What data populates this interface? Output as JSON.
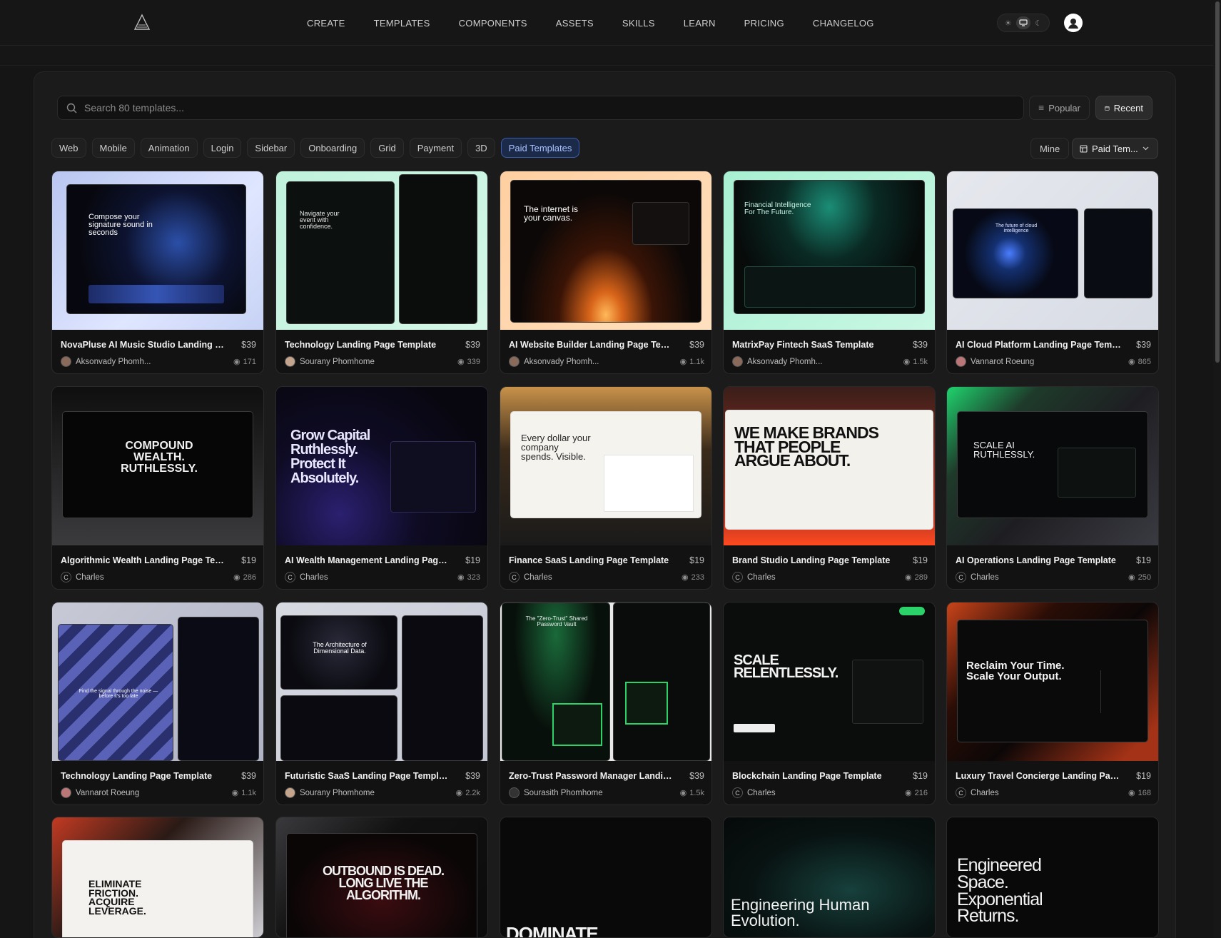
{
  "nav": {
    "items": [
      "CREATE",
      "TEMPLATES",
      "COMPONENTS",
      "ASSETS",
      "SKILLS",
      "LEARN",
      "PRICING",
      "CHANGELOG"
    ]
  },
  "search": {
    "placeholder": "Search 80 templates..."
  },
  "sort": {
    "popular": "Popular",
    "recent": "Recent",
    "active": "Recent"
  },
  "filters": {
    "chips": [
      "Web",
      "Mobile",
      "Animation",
      "Login",
      "Sidebar",
      "Onboarding",
      "Grid",
      "Payment",
      "3D",
      "Paid Templates"
    ],
    "selected": "Paid Templates",
    "mine": "Mine",
    "dropdown": "Paid Tem..."
  },
  "cards": [
    {
      "title": "NovaPluse AI Music Studio Landing Page...",
      "price": "$39",
      "author": "Aksonvady Phomh...",
      "views": "171",
      "hero": "Compose your signature sound in seconds"
    },
    {
      "title": "Technology Landing Page Template",
      "price": "$39",
      "author": "Sourany Phomhome",
      "views": "339",
      "hero": "Navigate your event with confidence."
    },
    {
      "title": "AI Website Builder Landing Page Template",
      "price": "$39",
      "author": "Aksonvady Phomh...",
      "views": "1.1k",
      "hero": "The internet is your canvas."
    },
    {
      "title": "MatrixPay Fintech SaaS Template",
      "price": "$39",
      "author": "Aksonvady Phomh...",
      "views": "1.5k",
      "hero": "Financial Intelligence For The Future."
    },
    {
      "title": "AI Cloud Platform Landing Page Template",
      "price": "$39",
      "author": "Vannarot Roeung",
      "views": "865",
      "hero": "The future of cloud intelligence"
    },
    {
      "title": "Algorithmic Wealth Landing Page Template",
      "price": "$19",
      "author": "Charles",
      "views": "286",
      "hero": "COMPOUND WEALTH. RUTHLESSLY."
    },
    {
      "title": "AI Wealth Management Landing Page Te...",
      "price": "$19",
      "author": "Charles",
      "views": "323",
      "hero": "Grow Capital Ruthlessly. Protect It Absolutely."
    },
    {
      "title": "Finance SaaS Landing Page Template",
      "price": "$19",
      "author": "Charles",
      "views": "233",
      "hero": "Every dollar your company spends. Visible."
    },
    {
      "title": "Brand Studio Landing Page Template",
      "price": "$19",
      "author": "Charles",
      "views": "289",
      "hero": "WE MAKE BRANDS THAT PEOPLE ARGUE ABOUT."
    },
    {
      "title": "AI Operations Landing Page Template",
      "price": "$19",
      "author": "Charles",
      "views": "250",
      "hero": "SCALE AI RUTHLESSLY."
    },
    {
      "title": "Technology Landing Page Template",
      "price": "$39",
      "author": "Vannarot Roeung",
      "views": "1.1k",
      "hero": "Find the signal through the noise — before it's too late"
    },
    {
      "title": "Futuristic SaaS Landing Page Template",
      "price": "$39",
      "author": "Sourany Phomhome",
      "views": "2.2k",
      "hero": "The Architecture of Dimensional Data."
    },
    {
      "title": "Zero-Trust Password Manager Landing P...",
      "price": "$39",
      "author": "Sourasith Phomhome",
      "views": "1.5k",
      "hero": "The \"Zero-Trust\" Shared Password Vault"
    },
    {
      "title": "Blockchain Landing Page Template",
      "price": "$19",
      "author": "Charles",
      "views": "216",
      "hero": "SCALE RELENTLESSLY."
    },
    {
      "title": "Luxury Travel Concierge Landing Page Te...",
      "price": "$19",
      "author": "Charles",
      "views": "168",
      "hero": "Reclaim Your Time. Scale Your Output."
    },
    {
      "hero": "ELIMINATE FRICTION. ACQUIRE LEVERAGE."
    },
    {
      "hero": "OUTBOUND IS DEAD. LONG LIVE THE ALGORITHM."
    },
    {
      "hero": "DOMINATE"
    },
    {
      "hero": "Engineering Human Evolution."
    },
    {
      "hero": "Engineered Space. Exponential Returns."
    }
  ],
  "colors": {
    "accent": "#3b5fb0",
    "background": "#151515",
    "panel": "#1b1b1b"
  }
}
